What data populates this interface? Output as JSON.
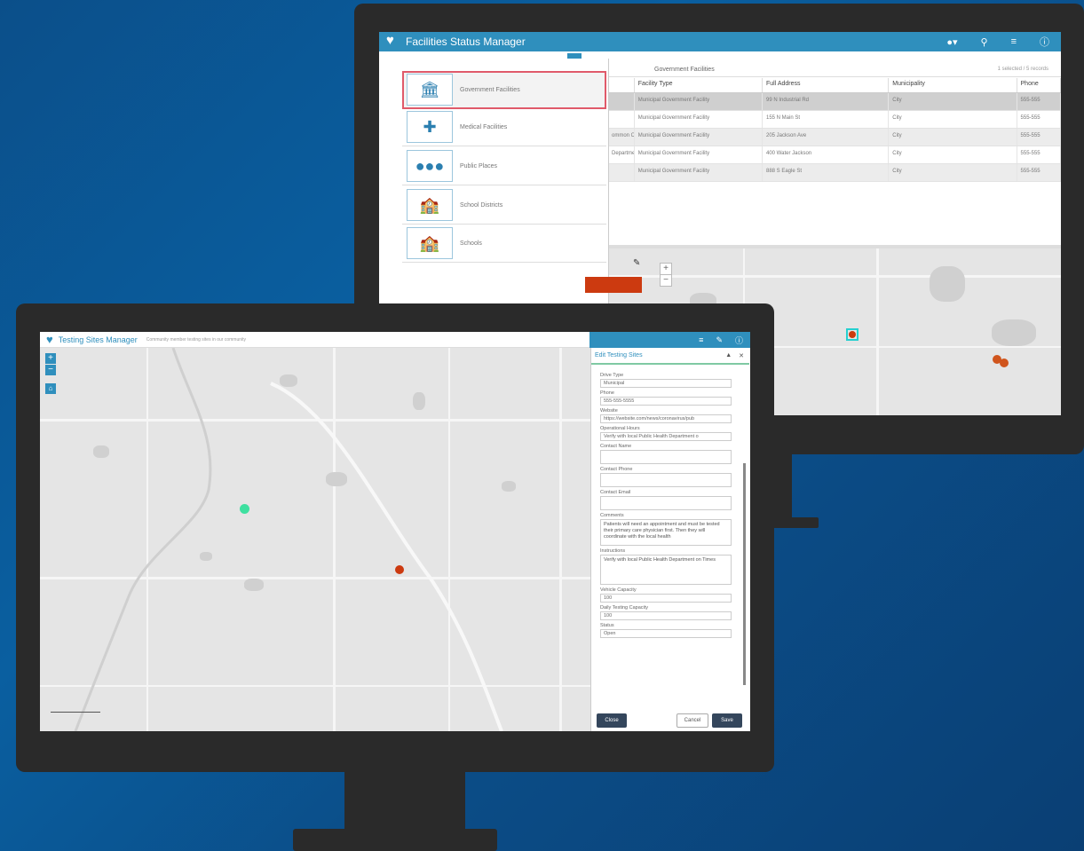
{
  "back_window": {
    "title": "Facilities Status Manager",
    "toolbar_icons": [
      "people-icon",
      "search-icon",
      "list-icon",
      "info-icon"
    ],
    "grid_title": "Government Facilities",
    "grid_count": "1 selected / 5 records",
    "columns": [
      "Facility Type",
      "Full Address",
      "Municipality",
      "Phone"
    ],
    "rows": [
      [
        "Municipal Government Facility",
        "99 N Industrial Rd",
        "City",
        "555-555"
      ],
      [
        "Municipal Government Facility",
        "155 N Main St",
        "City",
        "555-555"
      ],
      [
        "Municipal Government Facility",
        "205 Jackson Ave",
        "City",
        "555-555"
      ],
      [
        "Municipal Government Facility",
        "400 Water Jackson",
        "City",
        "555-555"
      ],
      [
        "Municipal Government Facility",
        "888 S Eagle St",
        "City",
        "555-555"
      ]
    ],
    "row_prefixes": [
      "",
      "",
      "ommon Offices",
      "Department",
      ""
    ],
    "side_panel": [
      {
        "icon": "bank-icon",
        "label": "Government Facilities"
      },
      {
        "icon": "medical-cross-icon",
        "label": "Medical Facilities"
      },
      {
        "icon": "people-group-icon",
        "label": "Public Places"
      },
      {
        "icon": "school-building-icon",
        "label": "School Districts"
      },
      {
        "icon": "school-icon",
        "label": "Schools"
      }
    ],
    "status_color": "#cc3a10"
  },
  "front_window": {
    "title": "Testing Sites Manager",
    "subtitle": "Community member testing sites in our community",
    "editor_title": "Edit Testing Sites",
    "fields": [
      {
        "label": "Drive Type",
        "value": "Municipal"
      },
      {
        "label": "Phone",
        "value": "555-555-5555"
      },
      {
        "label": "Website",
        "value": "https://website.com/news/coronavirus/pub"
      },
      {
        "label": "Operational Hours",
        "value": "Verify with local Public Health Department o"
      },
      {
        "label": "Contact Name",
        "value": ""
      },
      {
        "label": "Contact Phone",
        "value": ""
      },
      {
        "label": "Contact Email",
        "value": ""
      }
    ],
    "comments_label": "Comments",
    "comments_value": "Patients will need an appointment and must be tested their primary care physician first. Then they will coordinate with the local health",
    "instructions_label": "Instructions",
    "instructions_value": "Verify with local Public Health Department on Times",
    "capacity_label": "Vehicle Capacity",
    "capacity_value": "100",
    "daily_label": "Daily Testing Capacity",
    "daily_value": "100",
    "status_label": "Status",
    "status_value": "Open",
    "close_label": "Close",
    "cancel_label": "Cancel",
    "save_label": "Save",
    "accent": "#2f8fbd"
  }
}
